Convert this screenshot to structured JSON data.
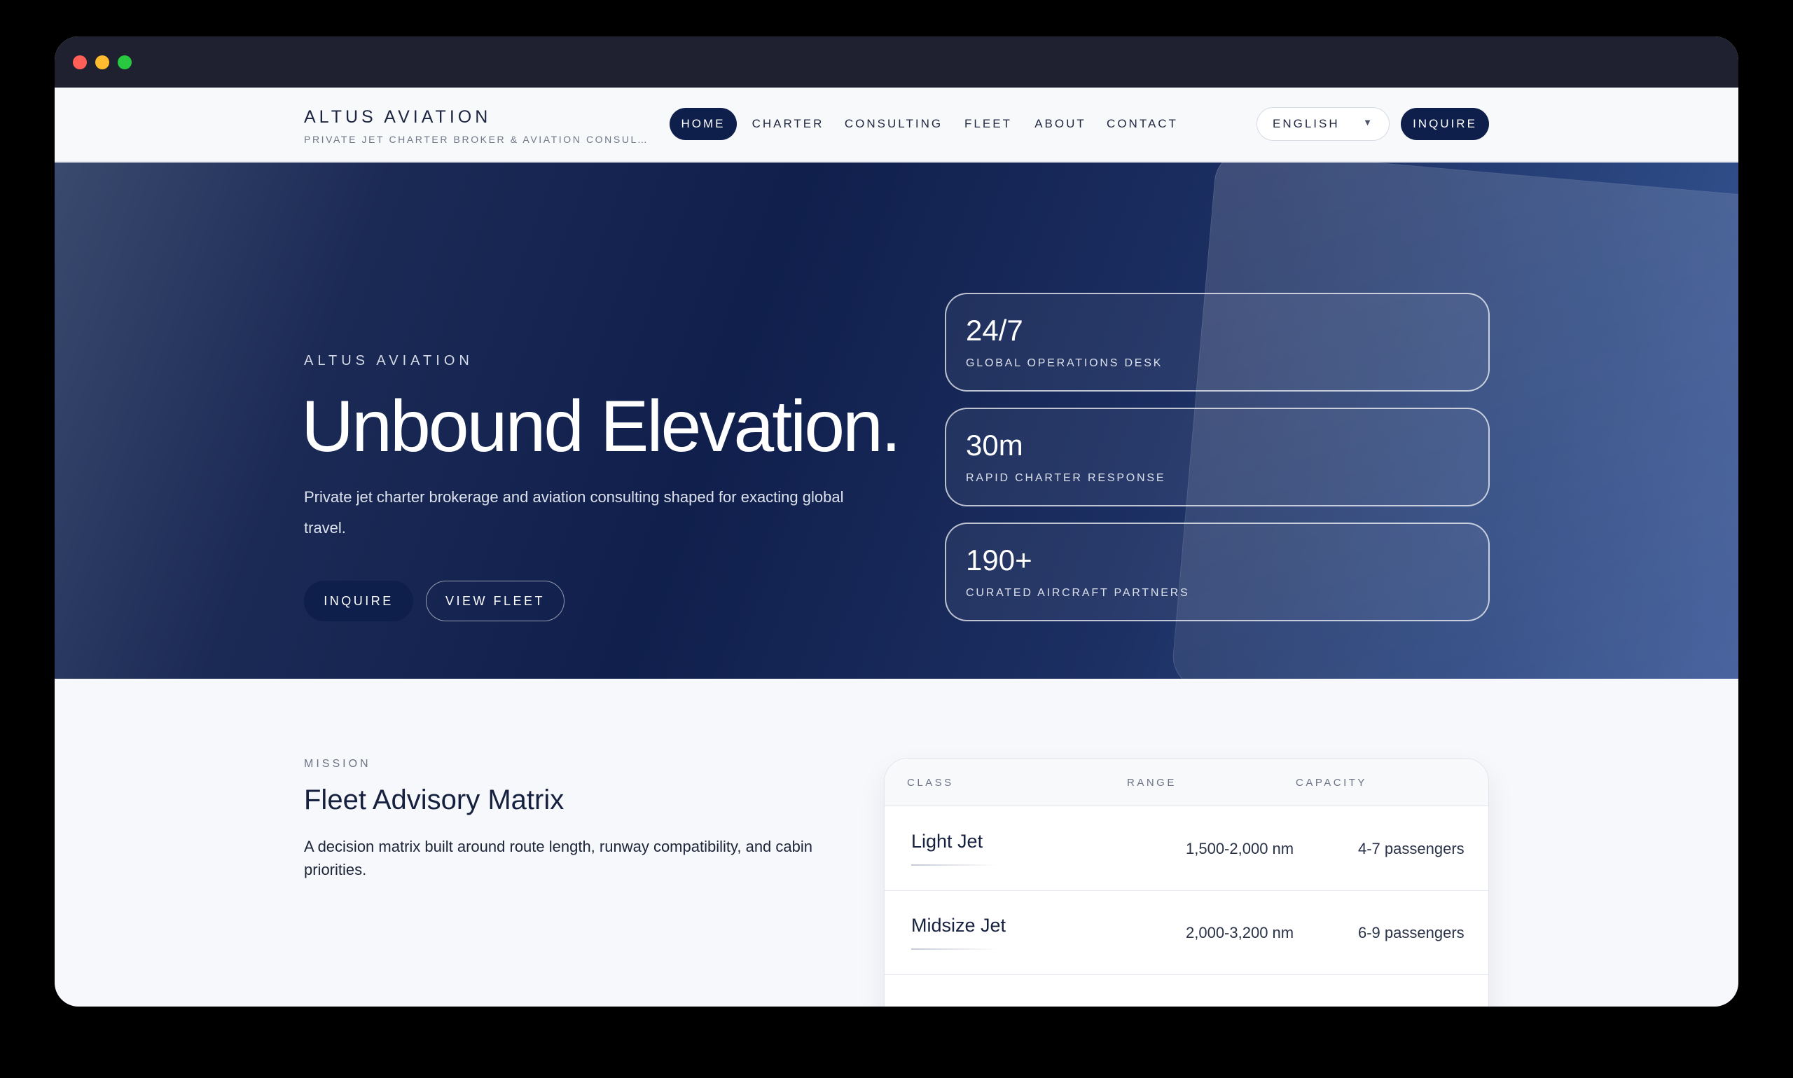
{
  "brand": {
    "name": "ALTUS AVIATION",
    "tagline": "PRIVATE JET CHARTER BROKER & AVIATION CONSULTING"
  },
  "nav": {
    "items": [
      {
        "label": "HOME",
        "active": true
      },
      {
        "label": "CHARTER",
        "active": false
      },
      {
        "label": "CONSULTING",
        "active": false
      },
      {
        "label": "FLEET",
        "active": false
      },
      {
        "label": "ABOUT",
        "active": false
      },
      {
        "label": "CONTACT",
        "active": false
      }
    ],
    "language": "ENGLISH",
    "cta": "INQUIRE"
  },
  "hero": {
    "eyebrow": "ALTUS AVIATION",
    "title": "Unbound Elevation.",
    "description": "Private jet charter brokerage and aviation consulting shaped for exacting global travel.",
    "buttons": {
      "primary": "INQUIRE",
      "secondary": "VIEW FLEET"
    },
    "stats": [
      {
        "value": "24/7",
        "label": "GLOBAL OPERATIONS DESK"
      },
      {
        "value": "30m",
        "label": "RAPID CHARTER RESPONSE"
      },
      {
        "value": "190+",
        "label": "CURATED AIRCRAFT PARTNERS"
      }
    ]
  },
  "mission": {
    "eyebrow": "MISSION",
    "title": "Fleet Advisory Matrix",
    "description": "A decision matrix built around route length, runway compatibility, and cabin priorities."
  },
  "matrix": {
    "headers": [
      "CLASS",
      "RANGE",
      "CAPACITY"
    ],
    "rows": [
      {
        "class": "Light Jet",
        "range": "1,500-2,000 nm",
        "capacity": "4-7 passengers"
      },
      {
        "class": "Midsize Jet",
        "range": "2,000-3,200 nm",
        "capacity": "6-9 passengers"
      }
    ]
  },
  "colors": {
    "navy": "#0f1f4b",
    "hero_gradient_start": "#3a4a6e",
    "hero_gradient_end": "#3d5a99",
    "page_background": "#f7f8fb"
  }
}
